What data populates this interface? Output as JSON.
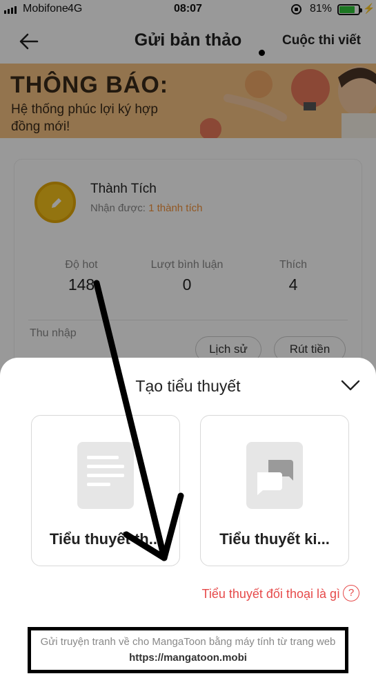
{
  "status_bar": {
    "carrier": "Mobifone",
    "network": "4G",
    "time": "08:07",
    "battery": "81%",
    "battery_level": 0.81
  },
  "nav": {
    "title": "Gửi bản thảo",
    "right_link": "Cuộc thi viết"
  },
  "banner": {
    "title": "THÔNG BÁO:",
    "text": "Hệ thống phúc lợi ký hợp đồng mới!"
  },
  "achievement": {
    "title": "Thành Tích",
    "received_label": "Nhận được: ",
    "received_count": "1 thành tích"
  },
  "stats": [
    {
      "label": "Độ hot",
      "value": "148"
    },
    {
      "label": "Lượt bình luận",
      "value": "0"
    },
    {
      "label": "Thích",
      "value": "4"
    }
  ],
  "income": {
    "label": "Thu nhập",
    "history_button": "Lịch sử",
    "withdraw_button": "Rút tiền"
  },
  "sheet": {
    "title": "Tạo tiểu thuyết",
    "options": [
      {
        "label": "Tiểu thuyết th...",
        "icon": "document-icon"
      },
      {
        "label": "Tiểu thuyết ki...",
        "icon": "chat-bubbles-icon"
      }
    ],
    "help_link": "Tiểu thuyết đối thoại là gì",
    "help_icon": "?",
    "footer_text": "Gửi truyện tranh về cho MangaToon bằng máy tính từ trang web ",
    "footer_url": "https://mangatoon.mobi"
  },
  "colors": {
    "accent_orange": "#f3923a",
    "link_red": "#e64a4a",
    "banner_bg": "#f6c283",
    "medal_gold": "#f6c21c"
  }
}
